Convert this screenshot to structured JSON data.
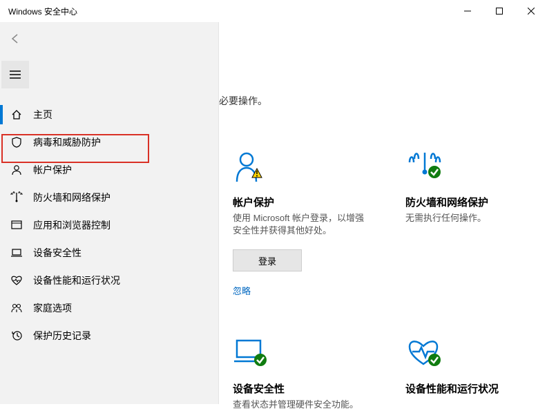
{
  "window": {
    "title": "Windows 安全中心"
  },
  "sidebar": {
    "items": [
      {
        "label": "主页",
        "icon": "home-icon"
      },
      {
        "label": "病毒和威胁防护",
        "icon": "shield-icon"
      },
      {
        "label": "帐户保护",
        "icon": "account-icon"
      },
      {
        "label": "防火墙和网络保护",
        "icon": "firewall-icon"
      },
      {
        "label": "应用和浏览器控制",
        "icon": "app-browser-icon"
      },
      {
        "label": "设备安全性",
        "icon": "device-security-icon"
      },
      {
        "label": "设备性能和运行状况",
        "icon": "health-icon"
      },
      {
        "label": "家庭选项",
        "icon": "family-icon"
      },
      {
        "label": "保护历史记录",
        "icon": "history-icon"
      }
    ]
  },
  "main": {
    "partial_visible_text": "必要操作。",
    "cards": {
      "account": {
        "title": "帐户保护",
        "desc": "使用 Microsoft 帐户登录，以增强安全性并获得其他好处。",
        "button": "登录",
        "link": "忽略"
      },
      "firewall": {
        "title": "防火墙和网络保护",
        "desc": "无需执行任何操作。"
      },
      "device_security": {
        "title": "设备安全性",
        "desc": "查看状态并管理硬件安全功能。"
      },
      "health": {
        "title": "设备性能和运行状况",
        "desc": ""
      }
    }
  }
}
